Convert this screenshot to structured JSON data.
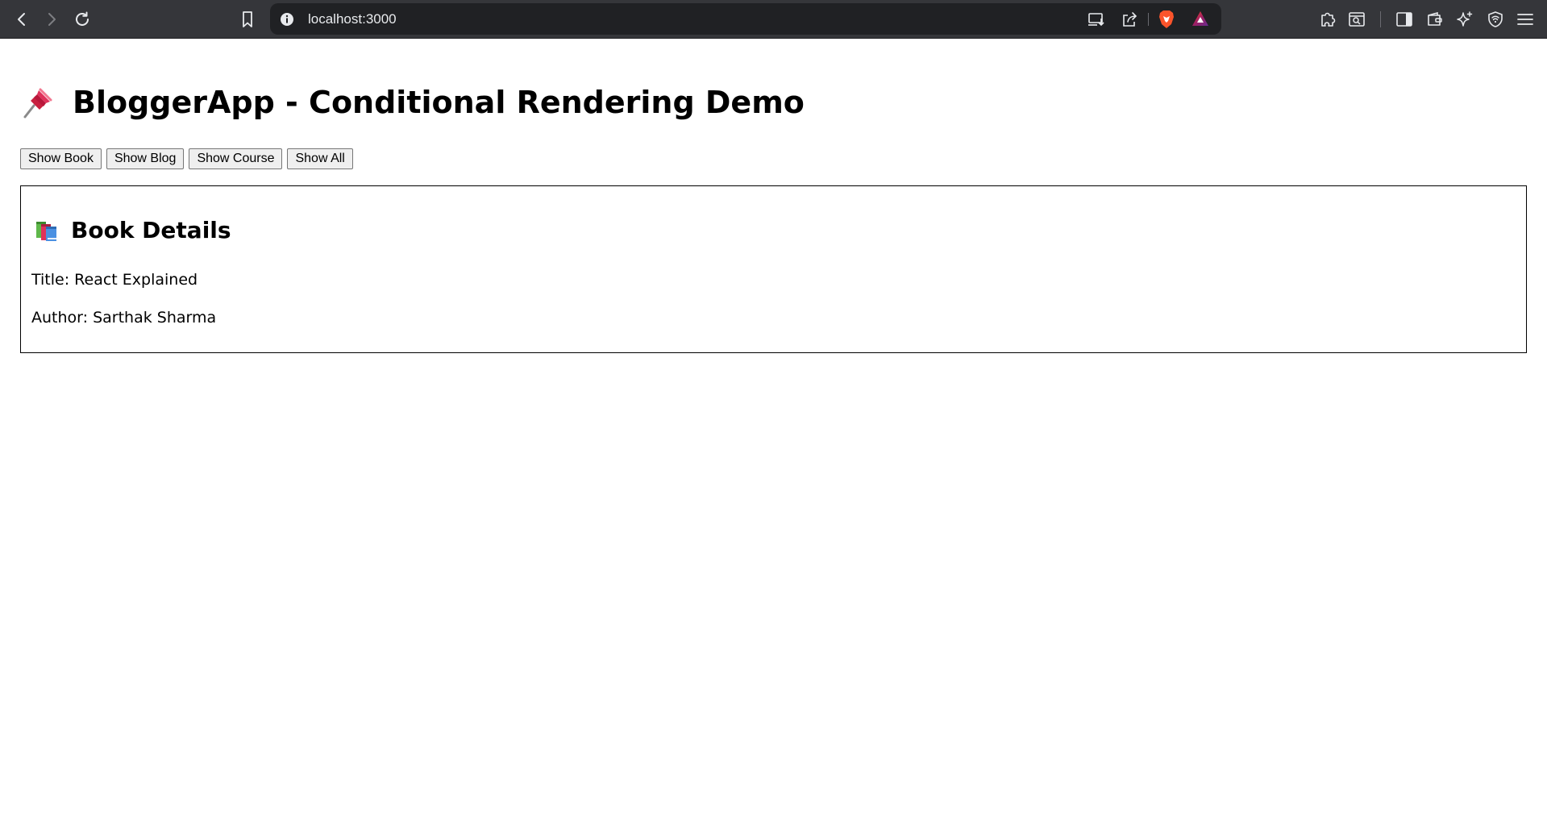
{
  "browser": {
    "url": "localhost:3000",
    "icons": {
      "back": "chevron-left-icon",
      "forward": "chevron-right-icon",
      "reload": "reload-icon",
      "bookmark": "bookmark-icon",
      "site_info": "info-icon",
      "install": "install-app-icon",
      "share": "share-icon",
      "brave": "brave-shields-icon",
      "rewards": "brave-rewards-icon",
      "extensions": "puzzle-icon",
      "page_search": "page-search-icon",
      "sidebar": "sidebar-icon",
      "wallet": "wallet-icon",
      "leo": "sparkle-icon",
      "vpn": "shield-icon",
      "menu": "hamburger-menu-icon"
    },
    "colors": {
      "toolbar": "#35363a",
      "urlbar": "#202124",
      "brave_orange": "#fb542b"
    }
  },
  "app": {
    "title": "BloggerApp - Conditional Rendering Demo",
    "title_icon": "pushpin-icon",
    "buttons": [
      {
        "label": "Show Book"
      },
      {
        "label": "Show Blog"
      },
      {
        "label": "Show Course"
      },
      {
        "label": "Show All"
      }
    ],
    "details": {
      "heading": "Book Details",
      "heading_icon": "books-icon",
      "title_line": "Title: React Explained",
      "author_line": "Author: Sarthak Sharma"
    }
  }
}
